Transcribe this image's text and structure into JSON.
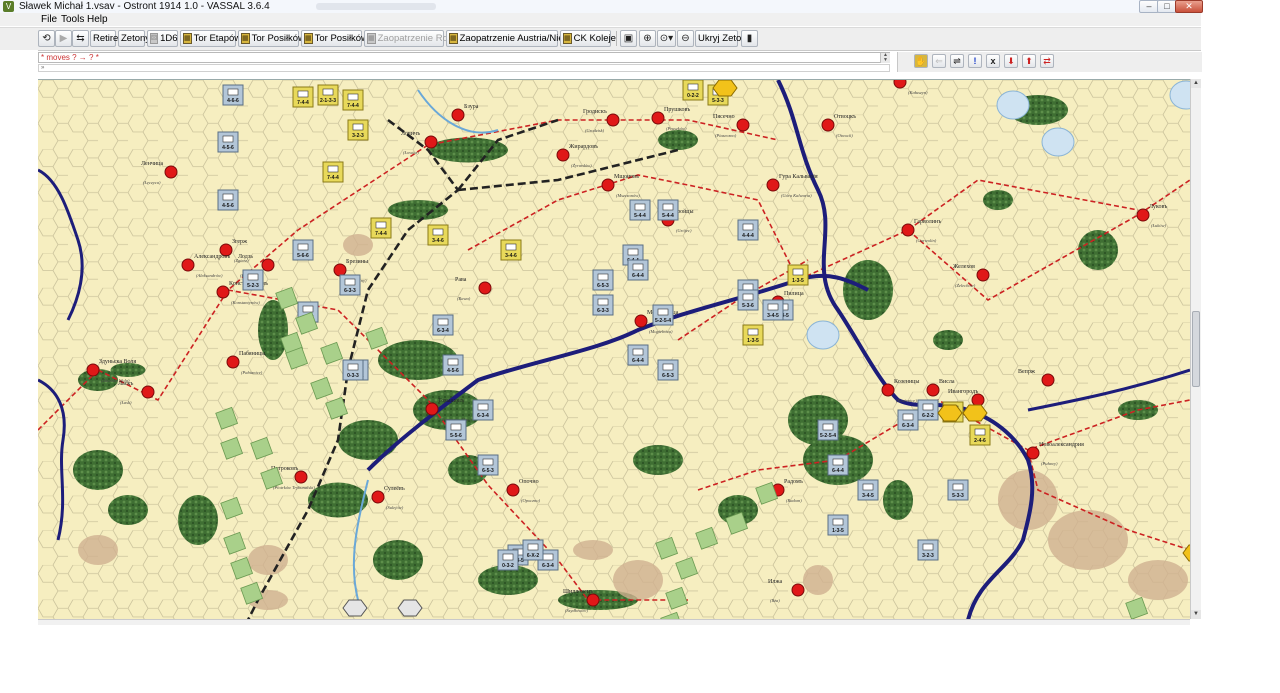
{
  "window": {
    "title": "Sławek Michał 1.vsav - Ostront 1914 1.0 - VASSAL 3.6.4",
    "minimize": "–",
    "maximize": "□",
    "close": "✕"
  },
  "menu": [
    "File",
    "Tools",
    "Help"
  ],
  "toolbar": {
    "retire": "Retire",
    "zetony": "Zetony",
    "d6": "1D6",
    "tor_etapow": "Tor Etapów",
    "tor_posilkow_1": "Tor Posiłków",
    "tor_posilkow_2": "Tor Posiłków",
    "zaopatrzenie_rosja": "Zaopatrzenie Rosja",
    "zaopatrzenie_austria": "Zaopatrzenie Austria/Niemcy",
    "ck_koleje": "CK Koleje",
    "ukryj_zetony": "Ukryj Zetony"
  },
  "chat": {
    "line": "* moves ? → ? *"
  },
  "icons": {
    "logo": "vassal-app-icon",
    "step": "step-icon",
    "refresh": "refresh-icon",
    "zoom_in": "zoom-in-icon",
    "zoom_select": "zoom-select-icon",
    "zoom_out": "zoom-out-icon"
  },
  "map": {
    "colors": {
      "land": "#f6eec0",
      "hexline": "#c9c09a",
      "river": "#1d1d7a",
      "minor_river": "#6aa8d8",
      "forest": "#4a7a3a",
      "marsh": "#cfb090",
      "road": "#cc2222",
      "rail": "#222222",
      "city": "#e01818"
    },
    "cities": [
      {
        "name": "Ленчица",
        "sub": "(Łęczyca)"
      },
      {
        "name": "Згерж",
        "sub": "(Zgierz)"
      },
      {
        "name": "Александровъ",
        "sub": "(Aleksandrów)"
      },
      {
        "name": "Лодзь",
        "sub": "(Łódź)"
      },
      {
        "name": "Константиновъ",
        "sub": "(Konstantynów)"
      },
      {
        "name": "Здуньска Воля",
        "sub": "(Zduńska Wola)"
      },
      {
        "name": "Ласкъ",
        "sub": "(Łask)"
      },
      {
        "name": "Пабяницы",
        "sub": "(Pabianice)"
      },
      {
        "name": "Брезины",
        "sub": "(Brzeziny)"
      },
      {
        "name": "Ловичъ",
        "sub": "(Łowicz)"
      },
      {
        "name": "Жирардовъ",
        "sub": "(Żyrardów)"
      },
      {
        "name": "Прушковъ",
        "sub": "(Pruszków)"
      },
      {
        "name": "Гродискъ",
        "sub": "(Grodzisk)"
      },
      {
        "name": "Мщоновъ",
        "sub": "(Mszczonów)"
      },
      {
        "name": "Гройцы",
        "sub": "(Grójec)"
      },
      {
        "name": "Рава",
        "sub": "(Rawa)"
      },
      {
        "name": "Могельница",
        "sub": "(Mogielnica)"
      },
      {
        "name": "Томашовъ",
        "sub": "(Tomaszów Maz.)"
      },
      {
        "name": "Петроковъ",
        "sub": "(Piotrków Trybunalski)"
      },
      {
        "name": "Сулеёвъ",
        "sub": "(Sulejów)"
      },
      {
        "name": "Опочно",
        "sub": "(Opoczno)"
      },
      {
        "name": "Шидловецъ",
        "sub": "(Szydłowiec)"
      },
      {
        "name": "Радомъ",
        "sub": "(Radom)"
      },
      {
        "name": "Козеницы",
        "sub": "(Kozienice)"
      },
      {
        "name": "Ивангородъ",
        "sub": "(Dęblin)"
      },
      {
        "name": "Новоалександрия",
        "sub": "(Puławy)"
      },
      {
        "name": "Гарволинъ",
        "sub": "(Garwolin)"
      },
      {
        "name": "Желехов",
        "sub": "(Żelechów)"
      },
      {
        "name": "Луковъ",
        "sub": "(Łuków)"
      },
      {
        "name": "Отвоцкъ",
        "sub": "(Otwock)"
      },
      {
        "name": "Пясечно",
        "sub": "(Piaseczno)"
      },
      {
        "name": "Гура Кальварія",
        "sub": "(Góra Kalwaria)"
      },
      {
        "name": "Калушинъ",
        "sub": "(Kałuszyn)"
      },
      {
        "name": "Илжа",
        "sub": "(Iłża)"
      },
      {
        "name": "Пилица",
        "sub": ""
      },
      {
        "name": "Висла",
        "sub": ""
      },
      {
        "name": "Вепрж",
        "sub": ""
      },
      {
        "name": "Бзура",
        "sub": ""
      }
    ],
    "units": [
      {
        "s": "4-6-6",
        "c": "blue"
      },
      {
        "s": "7-4-4",
        "c": "yellow"
      },
      {
        "s": "2-1-3-3",
        "c": "yellow"
      },
      {
        "s": "7-4-4",
        "c": "yellow"
      },
      {
        "s": "3-2-3",
        "c": "yellow"
      },
      {
        "s": "4-5-6",
        "c": "blue"
      },
      {
        "s": "7-4-4",
        "c": "yellow"
      },
      {
        "s": "4-5-6",
        "c": "blue"
      },
      {
        "s": "7-4-4",
        "c": "yellow"
      },
      {
        "s": "3-4-6",
        "c": "yellow"
      },
      {
        "s": "5-6-6",
        "c": "blue"
      },
      {
        "s": "6-3-3",
        "c": "blue"
      },
      {
        "s": "5-2-3",
        "c": "blue"
      },
      {
        "s": "6-3-2",
        "c": "blue"
      },
      {
        "s": "6-3-4",
        "c": "blue"
      },
      {
        "s": "4-5-6",
        "c": "blue"
      },
      {
        "s": "5-5-6",
        "c": "blue"
      },
      {
        "s": "6-3-2",
        "c": "blue"
      },
      {
        "s": "3-4-6",
        "c": "yellow"
      },
      {
        "s": "6-4-4",
        "c": "blue"
      },
      {
        "s": "6-5-3",
        "c": "blue"
      },
      {
        "s": "6-4-4",
        "c": "blue"
      },
      {
        "s": "6-3-3",
        "c": "blue"
      },
      {
        "s": "5-4-4",
        "c": "blue"
      },
      {
        "s": "5-4-4",
        "c": "blue"
      },
      {
        "s": "4-4-4",
        "c": "blue"
      },
      {
        "s": "6-4-4",
        "c": "blue"
      },
      {
        "s": "6-5-3",
        "c": "blue"
      },
      {
        "s": "1-3-5",
        "c": "yellow"
      },
      {
        "s": "3-3-5",
        "c": "blue"
      },
      {
        "s": "1-3-5",
        "c": "yellow"
      },
      {
        "s": "6-3-3",
        "c": "blue"
      },
      {
        "s": "5-3-3",
        "c": "yellow"
      },
      {
        "s": "0-2-2",
        "c": "yellow"
      },
      {
        "s": "5-2-5-4",
        "c": "blue"
      },
      {
        "s": "3-4-5",
        "c": "blue"
      },
      {
        "s": "5-3-6",
        "c": "blue"
      },
      {
        "s": "0-3-3",
        "c": "blue"
      },
      {
        "s": "6-3-4",
        "c": "blue"
      },
      {
        "s": "6-5-3",
        "c": "blue"
      },
      {
        "s": "1-3-5",
        "c": "blue"
      },
      {
        "s": "0-3-2",
        "c": "blue"
      },
      {
        "s": "6-3-4",
        "c": "blue"
      },
      {
        "s": "6-X-2",
        "c": "blue"
      },
      {
        "s": "5-2-5-4",
        "c": "blue"
      },
      {
        "s": "6-2-2",
        "c": "blue"
      },
      {
        "s": "1-3-5",
        "c": "blue"
      },
      {
        "s": "3-2-3",
        "c": "blue"
      },
      {
        "s": "6-4-4",
        "c": "blue"
      },
      {
        "s": "3-4-5",
        "c": "blue"
      },
      {
        "s": "2-4-6",
        "c": "yellow"
      },
      {
        "s": "2-4-6",
        "c": "yellow"
      },
      {
        "s": "6-3-4",
        "c": "blue"
      },
      {
        "s": "5-3-3",
        "c": "blue"
      }
    ]
  }
}
